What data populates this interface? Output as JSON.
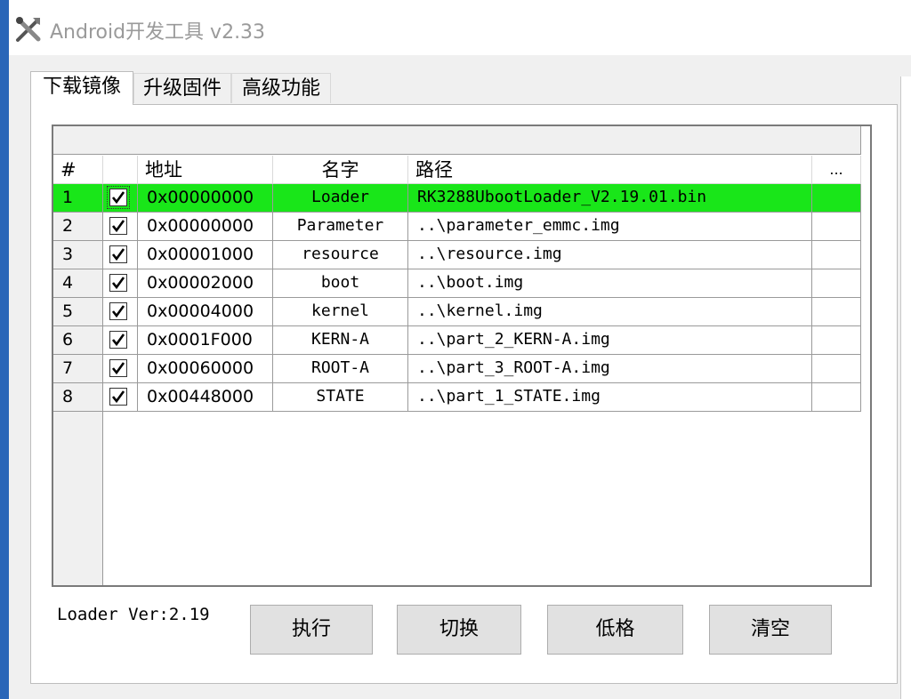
{
  "window": {
    "title": "Android开发工具 v2.33",
    "icon": "tools-icon"
  },
  "tabs": [
    {
      "label": "下载镜像",
      "active": true
    },
    {
      "label": "升级固件",
      "active": false
    },
    {
      "label": "高级功能",
      "active": false
    }
  ],
  "table": {
    "columns": [
      "#",
      "",
      "地址",
      "名字",
      "路径",
      "..."
    ],
    "rows": [
      {
        "num": "1",
        "checked": true,
        "address": "0x00000000",
        "name": "Loader",
        "path": "RK3288UbootLoader_V2.19.01.bin",
        "selected": true
      },
      {
        "num": "2",
        "checked": true,
        "address": "0x00000000",
        "name": "Parameter",
        "path": "..\\parameter_emmc.img",
        "selected": false
      },
      {
        "num": "3",
        "checked": true,
        "address": "0x00001000",
        "name": "resource",
        "path": "..\\resource.img",
        "selected": false
      },
      {
        "num": "4",
        "checked": true,
        "address": "0x00002000",
        "name": "boot",
        "path": "..\\boot.img",
        "selected": false
      },
      {
        "num": "5",
        "checked": true,
        "address": "0x00004000",
        "name": "kernel",
        "path": "..\\kernel.img",
        "selected": false
      },
      {
        "num": "6",
        "checked": true,
        "address": "0x0001F000",
        "name": "KERN-A",
        "path": "..\\part_2_KERN-A.img",
        "selected": false
      },
      {
        "num": "7",
        "checked": true,
        "address": "0x00060000",
        "name": "ROOT-A",
        "path": "..\\part_3_ROOT-A.img",
        "selected": false
      },
      {
        "num": "8",
        "checked": true,
        "address": "0x00448000",
        "name": "STATE",
        "path": "..\\part_1_STATE.img",
        "selected": false
      }
    ]
  },
  "footer": {
    "loader_version": "Loader Ver:2.19",
    "buttons": {
      "run": "执行",
      "switch": "切换",
      "low_format": "低格",
      "clear": "清空"
    }
  },
  "colors": {
    "selected_row": "#19e619",
    "window_border": "#2a66b8",
    "title_text": "#9a9a9a"
  }
}
